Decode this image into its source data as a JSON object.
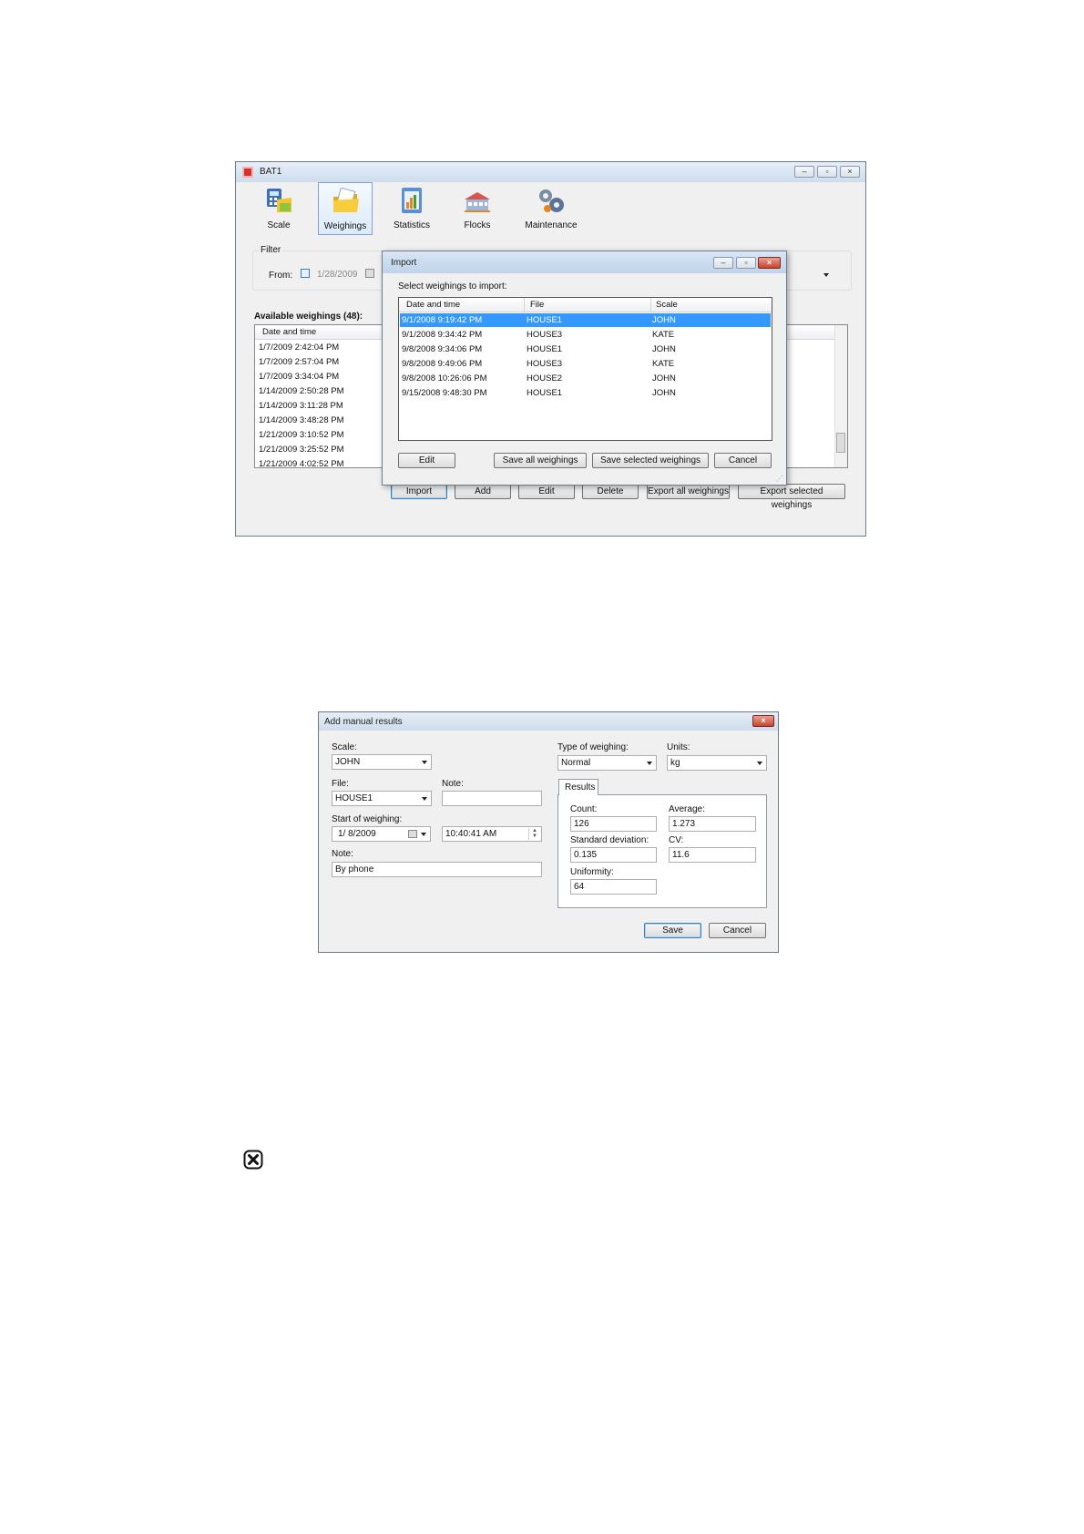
{
  "bat1": {
    "title": "BAT1",
    "toolbar": [
      {
        "label": "Scale"
      },
      {
        "label": "Weighings"
      },
      {
        "label": "Statistics"
      },
      {
        "label": "Flocks"
      },
      {
        "label": "Maintenance"
      }
    ],
    "filter": {
      "group_label": "Filter",
      "from_label": "From:",
      "from_value": "1/28/2009"
    },
    "available_label": "Available weighings (48):",
    "list": {
      "header_date": "Date and time",
      "rows": [
        "1/7/2009 2:42:04 PM",
        "1/7/2009 2:57:04 PM",
        "1/7/2009 3:34:04 PM",
        "1/14/2009 2:50:28 PM",
        "1/14/2009 3:11:28 PM",
        "1/14/2009 3:48:28 PM",
        "1/21/2009 3:10:52 PM",
        "1/21/2009 3:25:52 PM",
        "1/21/2009 4:02:52 PM"
      ]
    },
    "buttons": {
      "import": "Import",
      "add": "Add",
      "edit": "Edit",
      "delete": "Delete",
      "export_all": "Export all weighings",
      "export_selected": "Export selected weighings"
    }
  },
  "import_dialog": {
    "title": "Import",
    "prompt": "Select weighings to import:",
    "columns": {
      "date": "Date and time",
      "file": "File",
      "scale": "Scale"
    },
    "rows": [
      {
        "date": "9/1/2008 9:19:42 PM",
        "file": "HOUSE1",
        "scale": "JOHN",
        "selected": true
      },
      {
        "date": "9/1/2008 9:34:42 PM",
        "file": "HOUSE3",
        "scale": "KATE"
      },
      {
        "date": "9/8/2008 9:34:06 PM",
        "file": "HOUSE1",
        "scale": "JOHN"
      },
      {
        "date": "9/8/2008 9:49:06 PM",
        "file": "HOUSE3",
        "scale": "KATE"
      },
      {
        "date": "9/8/2008 10:26:06 PM",
        "file": "HOUSE2",
        "scale": "JOHN"
      },
      {
        "date": "9/15/2008 9:48:30 PM",
        "file": "HOUSE1",
        "scale": "JOHN"
      }
    ],
    "buttons": {
      "edit": "Edit",
      "save_all": "Save all weighings",
      "save_selected": "Save selected weighings",
      "cancel": "Cancel"
    }
  },
  "manual_dialog": {
    "title": "Add manual results",
    "scale_label": "Scale:",
    "scale_value": "JOHN",
    "file_label": "File:",
    "file_value": "HOUSE1",
    "file_note_label": "Note:",
    "file_note_value": "",
    "start_label": "Start of weighing:",
    "start_date": "1/  8/2009",
    "start_time": "10:40:41 AM",
    "note_label": "Note:",
    "note_value": "By phone",
    "type_label": "Type of weighing:",
    "type_value": "Normal",
    "units_label": "Units:",
    "units_value": "kg",
    "results_tab": "Results",
    "count_label": "Count:",
    "count_value": "126",
    "average_label": "Average:",
    "average_value": "1.273",
    "stddev_label": "Standard deviation:",
    "stddev_value": "0.135",
    "cv_label": "CV:",
    "cv_value": "11.6",
    "uniformity_label": "Uniformity:",
    "uniformity_value": "64",
    "save_button": "Save",
    "cancel_button": "Cancel"
  },
  "colors": {
    "selection": "#3399ff",
    "titlebar": "#cddcec",
    "close_button": "#c9442b"
  }
}
